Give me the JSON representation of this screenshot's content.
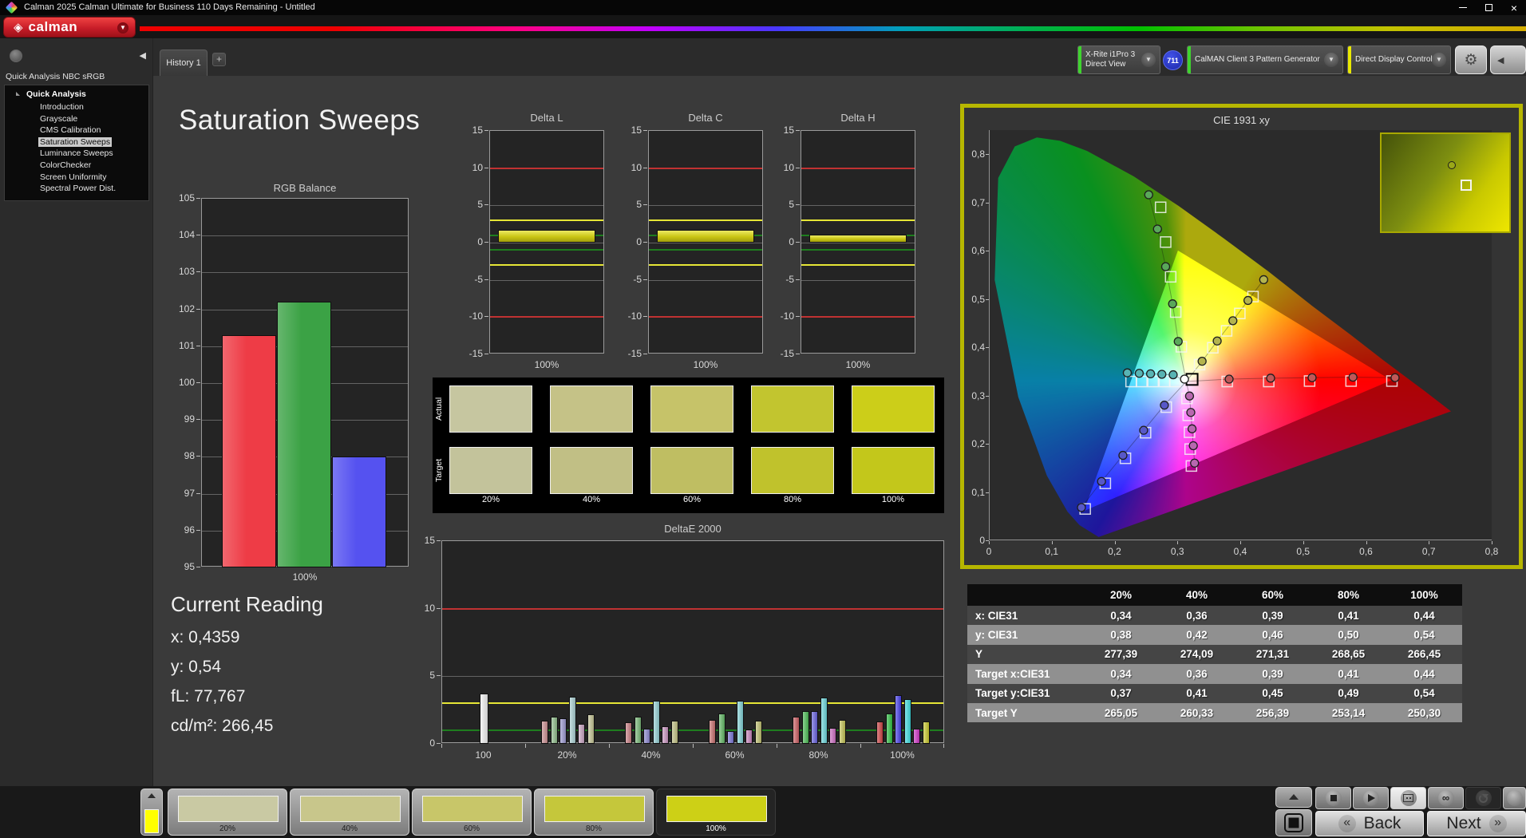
{
  "titlebar": {
    "title": "Calman 2025 Calman Ultimate for Business 110 Days Remaining  - Untitled"
  },
  "logo": {
    "brand": "calman"
  },
  "tabbar": {
    "tab": "History 1",
    "add": "+"
  },
  "toolbar": {
    "devices": [
      {
        "line1": "X-Rite i1Pro 3",
        "line2": "Direct View",
        "edge": "#3ed42e",
        "badge": "711"
      },
      {
        "line1": "CalMAN Client 3 Pattern Generator",
        "line2": "",
        "edge": "#3ed42e",
        "badge": ""
      },
      {
        "line1": "Direct Display Control",
        "line2": "",
        "edge": "#e8e800",
        "badge": ""
      }
    ]
  },
  "sidebar": {
    "header": "Quick Analysis NBC sRGB",
    "root": "Quick Analysis",
    "items": [
      "Introduction",
      "Grayscale",
      "CMS Calibration",
      "Saturation Sweeps",
      "Luminance Sweeps",
      "ColorChecker",
      "Screen Uniformity",
      "Spectral Power Dist."
    ],
    "selected_index": 3
  },
  "page": {
    "title": "Saturation Sweeps"
  },
  "current_reading": {
    "heading": "Current Reading",
    "lines": [
      "x: 0,4359",
      "y: 0,54",
      "fL: 77,767",
      "cd/m²: 266,45"
    ]
  },
  "chart_data": [
    {
      "id": "rgb_balance",
      "type": "bar",
      "title": "RGB Balance",
      "xlabel": "100%",
      "categories": [
        "Red",
        "Green",
        "Blue"
      ],
      "values": [
        101.3,
        102.2,
        98.0
      ],
      "colors": [
        "#ee3c46",
        "#3ba245",
        "#5552f0"
      ],
      "ylim": [
        95,
        105
      ],
      "ytick_step": 1
    },
    {
      "id": "delta_l",
      "type": "bar",
      "title": "Delta L",
      "xlabel": "100%",
      "categories": [
        "100%"
      ],
      "values": [
        1.75
      ],
      "ylim": [
        -15,
        15
      ],
      "yticks": [
        15,
        10,
        5,
        0,
        -5,
        -10,
        -15
      ],
      "limits": {
        "red": [
          10,
          -10
        ],
        "yellow": [
          3,
          -3
        ],
        "green": [
          1,
          -1
        ]
      }
    },
    {
      "id": "delta_c",
      "type": "bar",
      "title": "Delta C",
      "xlabel": "100%",
      "categories": [
        "100%"
      ],
      "values": [
        1.75
      ],
      "ylim": [
        -15,
        15
      ],
      "yticks": [
        15,
        10,
        5,
        0,
        -5,
        -10,
        -15
      ],
      "limits": {
        "red": [
          10,
          -10
        ],
        "yellow": [
          3,
          -3
        ],
        "green": [
          1,
          -1
        ]
      }
    },
    {
      "id": "delta_h",
      "type": "bar",
      "title": "Delta H",
      "xlabel": "100%",
      "categories": [
        "100%"
      ],
      "values": [
        1.1
      ],
      "ylim": [
        -15,
        15
      ],
      "yticks": [
        15,
        10,
        5,
        0,
        -5,
        -10,
        -15
      ],
      "limits": {
        "red": [
          10,
          -10
        ],
        "yellow": [
          3,
          -3
        ],
        "green": [
          1,
          -1
        ]
      }
    },
    {
      "id": "deltae_2000",
      "type": "bar",
      "title": "DeltaE 2000",
      "ylim": [
        0,
        15
      ],
      "yticks": [
        15,
        10,
        5,
        0
      ],
      "limits": {
        "red": 10,
        "yellow": 3,
        "green": 1
      },
      "groups": [
        {
          "label": "100",
          "values": [
            3.7
          ],
          "colors": [
            "#f0f0f0"
          ]
        },
        {
          "label": "20%",
          "values": [
            1.7,
            2.0,
            1.9,
            3.5,
            1.5,
            2.2
          ],
          "colors": [
            "#c98e90",
            "#8fbc8a",
            "#9a97cf",
            "#a9cfd2",
            "#c9a5c2",
            "#c3c394"
          ]
        },
        {
          "label": "40%",
          "values": [
            1.6,
            2.0,
            1.1,
            3.2,
            1.3,
            1.7
          ],
          "colors": [
            "#c97f84",
            "#79b878",
            "#8a86cf",
            "#93d0d4",
            "#c996c0",
            "#bfbf82"
          ]
        },
        {
          "label": "60%",
          "values": [
            1.75,
            2.25,
            0.95,
            3.2,
            1.05,
            1.7
          ],
          "colors": [
            "#c9716f",
            "#63b765",
            "#7a75d4",
            "#82d2d6",
            "#c985bd",
            "#bfbf70"
          ]
        },
        {
          "label": "80%",
          "values": [
            2.0,
            2.4,
            2.4,
            3.4,
            1.2,
            1.8
          ],
          "colors": [
            "#cb5f63",
            "#4cbb55",
            "#6862dc",
            "#6cd6da",
            "#cb6cc0",
            "#c3c356"
          ]
        },
        {
          "label": "100%",
          "values": [
            1.65,
            2.25,
            3.6,
            3.3,
            1.1,
            1.65
          ],
          "colors": [
            "#cd4345",
            "#2fbe42",
            "#4740e8",
            "#3edce0",
            "#cd35c5",
            "#c9c92e"
          ]
        }
      ]
    },
    {
      "id": "cie_1931",
      "type": "scatter",
      "title": "CIE 1931 xy",
      "xlim": [
        0,
        0.8
      ],
      "ylim": [
        0,
        0.85
      ],
      "xticks": [
        "0",
        "0,1",
        "0,2",
        "0,3",
        "0,4",
        "0,5",
        "0,6",
        "0,7",
        "0,8"
      ],
      "yticks": [
        "0",
        "0,1",
        "0,2",
        "0,3",
        "0,4",
        "0,5",
        "0,6",
        "0,7",
        "0,8"
      ],
      "white_point": [
        0.3127,
        0.329
      ],
      "highlight": {
        "square": [
          0.322,
          0.3335
        ],
        "circle": [
          0.31,
          0.334
        ]
      },
      "sweeps": [
        {
          "name": "red",
          "color": "#c05858",
          "targets": [
            [
              0.378,
              0.329
            ],
            [
              0.444,
              0.329
            ],
            [
              0.509,
              0.33
            ],
            [
              0.575,
              0.33
            ],
            [
              0.64,
              0.33
            ]
          ],
          "measured": [
            [
              0.381,
              0.334
            ],
            [
              0.447,
              0.336
            ],
            [
              0.513,
              0.337
            ],
            [
              0.578,
              0.338
            ],
            [
              0.645,
              0.337
            ]
          ]
        },
        {
          "name": "green",
          "color": "#5aa85a",
          "targets": [
            [
              0.305,
              0.401
            ],
            [
              0.296,
              0.473
            ],
            [
              0.288,
              0.546
            ],
            [
              0.28,
              0.618
            ],
            [
              0.272,
              0.69
            ]
          ],
          "measured": [
            [
              0.3,
              0.412
            ],
            [
              0.291,
              0.49
            ],
            [
              0.28,
              0.567
            ],
            [
              0.267,
              0.645
            ],
            [
              0.253,
              0.716
            ]
          ]
        },
        {
          "name": "blue",
          "color": "#5858c8",
          "targets": [
            [
              0.281,
              0.276
            ],
            [
              0.248,
              0.223
            ],
            [
              0.216,
              0.17
            ],
            [
              0.184,
              0.118
            ],
            [
              0.152,
              0.065
            ]
          ],
          "measured": [
            [
              0.278,
              0.28
            ],
            [
              0.245,
              0.228
            ],
            [
              0.212,
              0.176
            ],
            [
              0.178,
              0.122
            ],
            [
              0.146,
              0.068
            ]
          ]
        },
        {
          "name": "cyan",
          "color": "#58b4b4",
          "targets": [
            [
              0.295,
              0.329
            ],
            [
              0.278,
              0.329
            ],
            [
              0.26,
              0.329
            ],
            [
              0.242,
              0.329
            ],
            [
              0.225,
              0.329
            ]
          ],
          "measured": [
            [
              0.292,
              0.343
            ],
            [
              0.274,
              0.344
            ],
            [
              0.256,
              0.345
            ],
            [
              0.238,
              0.346
            ],
            [
              0.219,
              0.347
            ]
          ]
        },
        {
          "name": "magenta",
          "color": "#b868b0",
          "targets": [
            [
              0.314,
              0.294
            ],
            [
              0.316,
              0.259
            ],
            [
              0.318,
              0.224
            ],
            [
              0.319,
              0.189
            ],
            [
              0.321,
              0.154
            ]
          ],
          "measured": [
            [
              0.318,
              0.299
            ],
            [
              0.32,
              0.265
            ],
            [
              0.322,
              0.231
            ],
            [
              0.324,
              0.196
            ],
            [
              0.326,
              0.16
            ]
          ]
        },
        {
          "name": "yellow",
          "color": "#b4b44e",
          "targets": [
            [
              0.334,
              0.364
            ],
            [
              0.355,
              0.399
            ],
            [
              0.377,
              0.434
            ],
            [
              0.398,
              0.47
            ],
            [
              0.419,
              0.505
            ]
          ],
          "measured": [
            [
              0.338,
              0.371
            ],
            [
              0.362,
              0.413
            ],
            [
              0.387,
              0.455
            ],
            [
              0.411,
              0.497
            ],
            [
              0.436,
              0.54
            ]
          ]
        }
      ]
    }
  ],
  "swatch_panel": {
    "row_labels": [
      "Actual",
      "Target"
    ],
    "columns": [
      "20%",
      "40%",
      "60%",
      "80%",
      "100%"
    ],
    "actual_colors": [
      "#c6c6a0",
      "#c5c287",
      "#c6c369",
      "#c2c52f",
      "#ccce19"
    ],
    "target_colors": [
      "#c3c39b",
      "#c1bf85",
      "#bfbe62",
      "#c0c22c",
      "#c3c71b"
    ]
  },
  "table": {
    "columns": [
      "20%",
      "40%",
      "60%",
      "80%",
      "100%"
    ],
    "rows": [
      {
        "label": "x: CIE31",
        "values": [
          "0,34",
          "0,36",
          "0,39",
          "0,41",
          "0,44"
        ]
      },
      {
        "label": "y: CIE31",
        "values": [
          "0,38",
          "0,42",
          "0,46",
          "0,50",
          "0,54"
        ]
      },
      {
        "label": "Y",
        "values": [
          "277,39",
          "274,09",
          "271,31",
          "268,65",
          "266,45"
        ]
      },
      {
        "label": "Target x:CIE31",
        "values": [
          "0,34",
          "0,36",
          "0,39",
          "0,41",
          "0,44"
        ]
      },
      {
        "label": "Target y:CIE31",
        "values": [
          "0,37",
          "0,41",
          "0,45",
          "0,49",
          "0,54"
        ]
      },
      {
        "label": "Target Y",
        "values": [
          "265,05",
          "260,33",
          "256,39",
          "253,14",
          "250,30"
        ]
      }
    ]
  },
  "bottom_bar": {
    "quick_color": "#ffff00",
    "swatches": [
      {
        "label": "20%",
        "color": "#c9c9a3",
        "selected": false
      },
      {
        "label": "40%",
        "color": "#c8c68b",
        "selected": false
      },
      {
        "label": "60%",
        "color": "#c8c669",
        "selected": false
      },
      {
        "label": "80%",
        "color": "#c5c73b",
        "selected": false
      },
      {
        "label": "100%",
        "color": "#cdd016",
        "selected": true
      }
    ],
    "back": "Back",
    "next": "Next"
  }
}
